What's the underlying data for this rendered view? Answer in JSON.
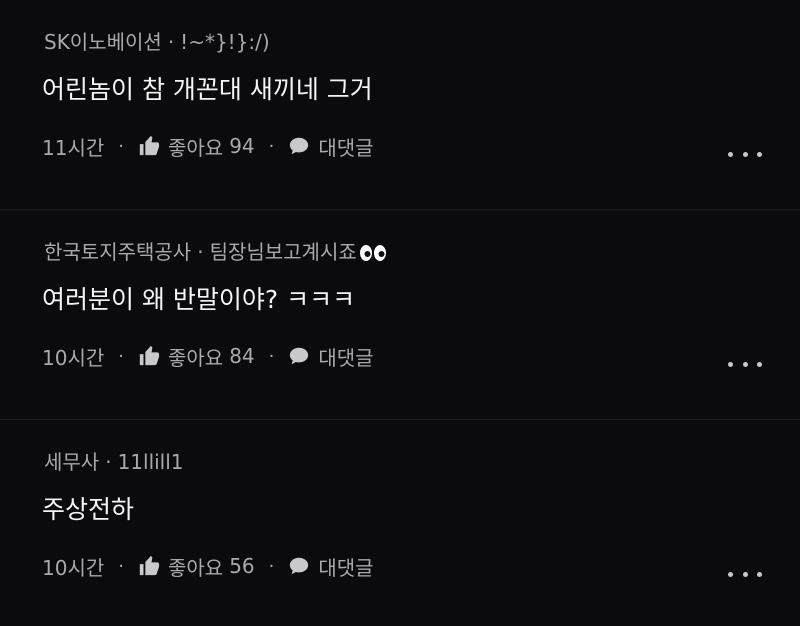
{
  "comments": [
    {
      "author": "SK이노베이션",
      "nickname": "!~*}!}:/)",
      "text": "어린놈이 참 개꼰대 새끼네 그거",
      "time": "11시간",
      "like_label": "좋아요",
      "likes": "94",
      "reply_label": "대댓글"
    },
    {
      "author": "한국토지주택공사",
      "nickname": "팀장님보고계시죠",
      "nickname_emoji": "eyes-emoji",
      "text": "여러분이 왜 반말이야? ㅋㅋㅋ",
      "time": "10시간",
      "like_label": "좋아요",
      "likes": "84",
      "reply_label": "대댓글"
    },
    {
      "author": "세무사",
      "nickname": "11llill1",
      "text": "주상전하",
      "time": "10시간",
      "like_label": "좋아요",
      "likes": "56",
      "reply_label": "대댓글"
    }
  ],
  "separator": "·",
  "icons": {
    "like": "thumbs-up-icon",
    "reply": "speech-bubble-icon",
    "more": "more-dots-icon"
  },
  "colors": {
    "background": "#0b0b0d",
    "text_primary": "#f4f4f4",
    "text_secondary": "#a9a9ad"
  }
}
